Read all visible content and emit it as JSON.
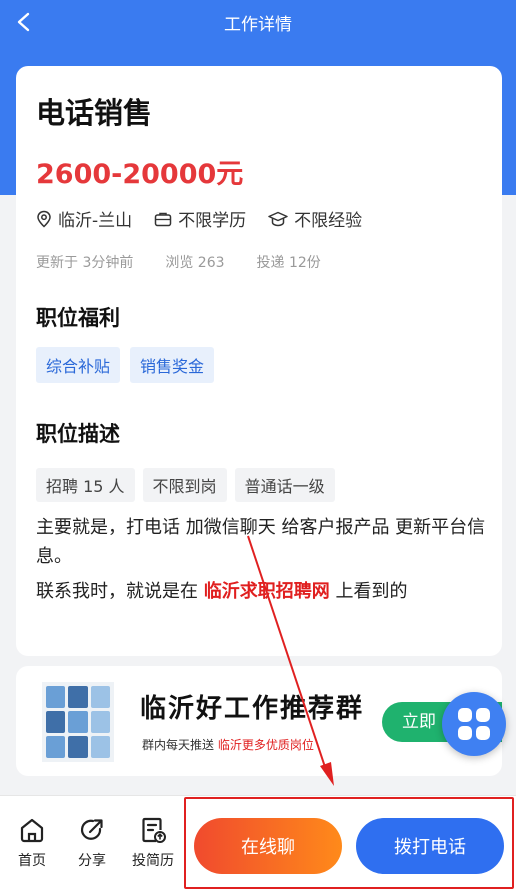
{
  "header": {
    "title": "工作详情"
  },
  "job": {
    "title": "电话销售",
    "salary": "2600-20000元",
    "location": "临沂-兰山",
    "education": "不限学历",
    "experience": "不限经验",
    "updated": "更新于 3分钟前",
    "views": "浏览 263",
    "applications": "投递 12份"
  },
  "benefits": {
    "title": "职位福利",
    "items": [
      "综合补贴",
      "销售奖金"
    ]
  },
  "description": {
    "title": "职位描述",
    "tags": [
      "招聘 15 人",
      "不限到岗",
      "普通话一级"
    ],
    "line1": "主要就是，打电话 加微信聊天 给客户报产品 更新平台信息。",
    "line2_prefix": "联系我时，就说是在",
    "line2_highlight": "临沂求职招聘网",
    "line2_suffix": "上看到的"
  },
  "promo": {
    "title": "临沂好工作推荐群",
    "subtitle_prefix": "群内每天推送",
    "subtitle_highlight": "临沂更多优质岗位",
    "button": "立即"
  },
  "bottom_nav": {
    "home": "首页",
    "share": "分享",
    "resume": "投简历"
  },
  "actions": {
    "chat": "在线聊",
    "call": "拨打电话"
  },
  "colors": {
    "brand_blue": "#3a7bf0",
    "salary_red": "#e5383b",
    "chat_orange": "#f04a2e",
    "call_blue": "#2f6ff0",
    "annotation_red": "#e02020"
  }
}
